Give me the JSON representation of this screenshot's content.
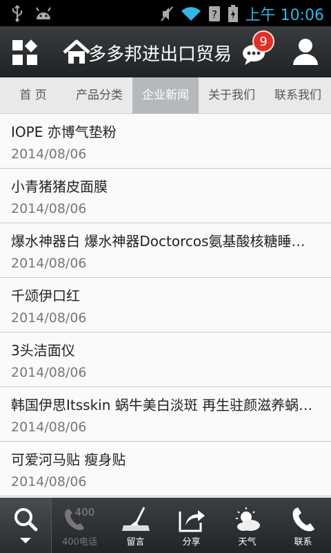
{
  "status": {
    "time": "上午 10:06"
  },
  "header": {
    "title": "多多邦进出口贸易",
    "badge_count": "9"
  },
  "tabs": [
    {
      "label": "首 页"
    },
    {
      "label": "产品分类"
    },
    {
      "label": "企业新闻"
    },
    {
      "label": "关于我们"
    },
    {
      "label": "联系我们"
    }
  ],
  "news": [
    {
      "title": "IOPE 亦博气垫粉",
      "date": "2014/08/06"
    },
    {
      "title": "小青猪猪皮面膜",
      "date": "2014/08/06"
    },
    {
      "title": "爆水神器白 爆水神器Doctorcos氨基酸核糖睡…",
      "date": "2014/08/06"
    },
    {
      "title": "千颂伊口红",
      "date": "2014/08/06"
    },
    {
      "title": "3头洁面仪",
      "date": "2014/08/06"
    },
    {
      "title": "韩国伊思Itsskin 蜗牛美白淡斑 再生驻颜滋养蜗…",
      "date": "2014/08/06"
    },
    {
      "title": "可爱河马贴 瘦身贴",
      "date": "2014/08/06"
    }
  ],
  "bottom_bar": {
    "phone_label": "400电话",
    "phone_icon_text": "400",
    "message_label": "留言",
    "share_label": "分享",
    "weather_label": "天气",
    "contact_label": "联系"
  }
}
